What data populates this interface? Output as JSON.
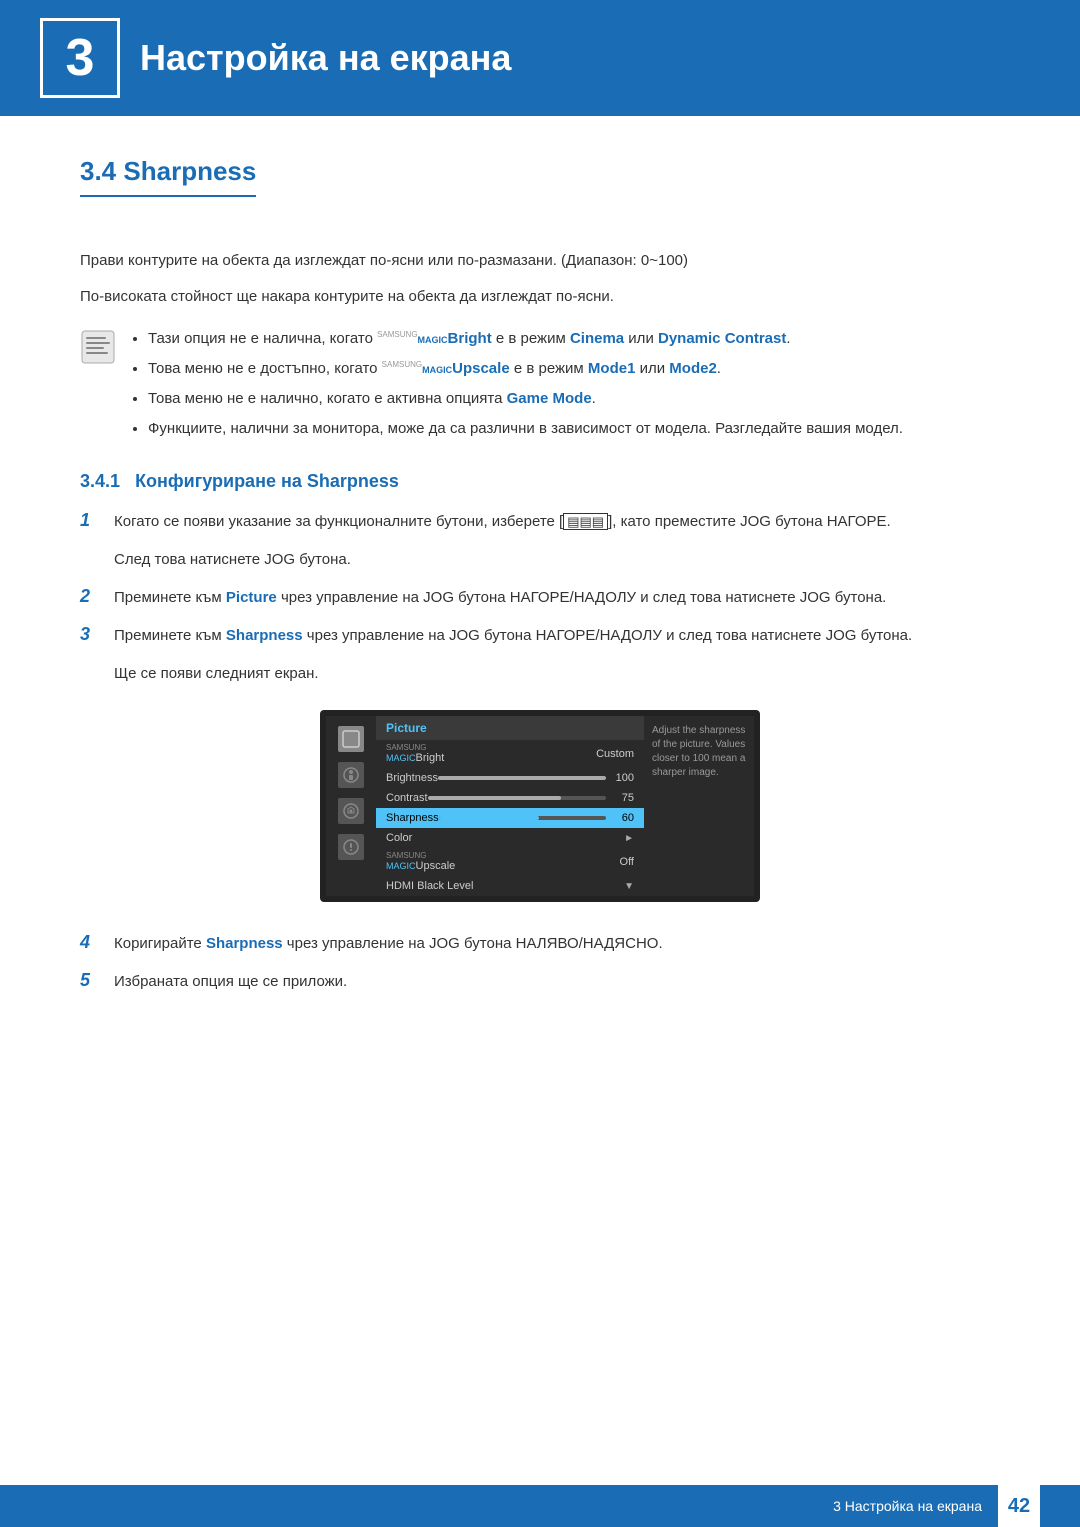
{
  "header": {
    "chapter_number": "3",
    "title": "Настройка на екрана"
  },
  "section": {
    "number": "3.4",
    "title": "Sharpness",
    "intro_line1": "Прави контурите на обекта да изглеждат по-ясни или по-размазани. (Диапазон: 0~100)",
    "intro_line2": "По-високата стойност ще накара контурите на обекта да изглеждат по-ясни.",
    "notes": [
      {
        "text_before": "Тази опция не е налична, когато ",
        "samsung1": "SAMSUNG",
        "magic1": "MAGIC",
        "brand_label": "Bright",
        "text_mid": " е в режим ",
        "highlight1": "Cinema",
        "text_mid2": " или ",
        "highlight2": "Dynamic Contrast",
        "text_after": "."
      },
      {
        "text_before": "Това меню не е достъпно, когато ",
        "samsung1": "SAMSUNG",
        "magic1": "MAGIC",
        "brand_label": "Upscale",
        "text_mid": " е в режим ",
        "highlight1": "Mode1",
        "text_mid2": " или ",
        "highlight2": "Mode2",
        "text_after": "."
      },
      {
        "text_before": "Това меню не е налично, когато е активна опцията ",
        "highlight1": "Game Mode",
        "text_after": "."
      },
      {
        "text_before": "Функциите, налични за монитора, може да са различни в зависимост от модела. Разгледайте вашия модел.",
        "highlight1": "",
        "text_after": ""
      }
    ],
    "subsection": {
      "number": "3.4.1",
      "title": "Конфигуриране на Sharpness"
    },
    "steps": [
      {
        "number": "1",
        "text": "Когато се появи указание за функционалните бутони, изберете [⊞], като преместите JOG бутона НАГОРЕ.",
        "sub": "След това натиснете JOG бутона."
      },
      {
        "number": "2",
        "text": "Преминете към Picture чрез управление на JOG бутона НАГОРЕ/НАДОЛУ и след това натиснете JOG бутона.",
        "picture_highlight": "Picture"
      },
      {
        "number": "3",
        "text_before": "Преминете към ",
        "sharpness_highlight": "Sharpness",
        "text_after": " чрез управление на JOG бутона НАГОРЕ/НАДОЛУ и след това натиснете JOG бутона.",
        "sub": "Ще се появи следният екран."
      },
      {
        "number": "4",
        "text_before": "Коригирайте ",
        "sharpness_highlight": "Sharpness",
        "text_after": " чрез управление на JOG бутона НАЛЯВО/НАДЯСНО."
      },
      {
        "number": "5",
        "text": "Избраната опция ще се приложи."
      }
    ],
    "monitor_menu": {
      "header": "Picture",
      "items": [
        {
          "label": "MAGICBright",
          "value": "Custom",
          "bar": false,
          "selected": false,
          "samsung": true
        },
        {
          "label": "Brightness",
          "value": "100",
          "bar": true,
          "fill": 100,
          "selected": false
        },
        {
          "label": "Contrast",
          "value": "75",
          "bar": true,
          "fill": 75,
          "selected": false
        },
        {
          "label": "Sharpness",
          "value": "60",
          "bar": true,
          "fill": 60,
          "selected": true
        },
        {
          "label": "Color",
          "value": "▶",
          "bar": false,
          "selected": false,
          "arrow": true
        },
        {
          "label": "MAGICUpscale",
          "value": "Off",
          "bar": false,
          "selected": false,
          "samsung": true
        },
        {
          "label": "HDMI Black Level",
          "value": "▼",
          "bar": false,
          "selected": false,
          "arrow": true
        }
      ],
      "tip": "Adjust the sharpness of the picture. Values closer to 100 mean a sharper image."
    }
  },
  "footer": {
    "chapter_label": "3 Настройка на екрана",
    "page_number": "42"
  }
}
